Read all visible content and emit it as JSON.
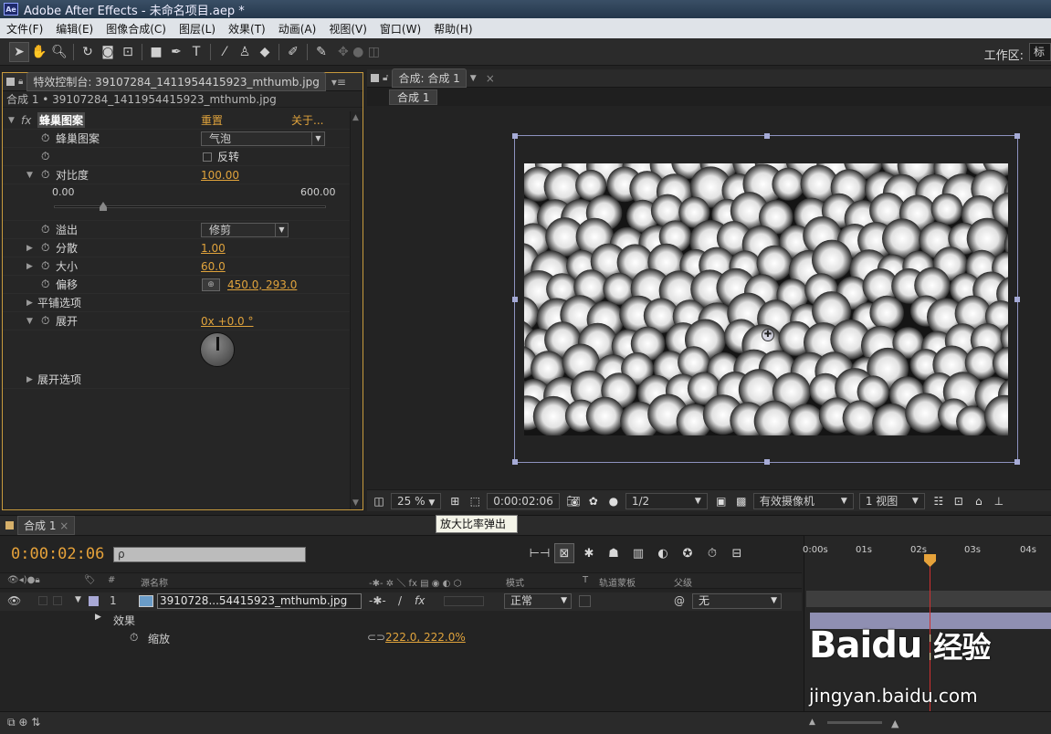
{
  "window": {
    "title": "Adobe After Effects - 未命名项目.aep *",
    "app_icon": "Ae"
  },
  "menu": [
    "文件(F)",
    "编辑(E)",
    "图像合成(C)",
    "图层(L)",
    "效果(T)",
    "动画(A)",
    "视图(V)",
    "窗口(W)",
    "帮助(H)"
  ],
  "toolbar": {
    "workspace_label": "工作区:",
    "workspace_value": "标"
  },
  "effect_controls": {
    "tab_title": "特效控制台: 39107284_1411954415923_mthumb.jpg",
    "subtitle": "合成 1 • 39107284_1411954415923_mthumb.jpg",
    "effect_name": "蜂巢图案",
    "reset_label": "重置",
    "about_label": "关于...",
    "props": {
      "pattern_label": "蜂巢图案",
      "pattern_value": "气泡",
      "invert_label": "反转",
      "contrast_label": "对比度",
      "contrast_value": "100.00",
      "slider_min": "0.00",
      "slider_max": "600.00",
      "overflow_label": "溢出",
      "overflow_value": "修剪",
      "disperse_label": "分散",
      "disperse_value": "1.00",
      "size_label": "大小",
      "size_value": "60.0",
      "offset_label": "偏移",
      "offset_value": "450.0, 293.0",
      "tiling_label": "平铺选项",
      "evolution_label": "展开",
      "evolution_value": "0x +0.0 °",
      "evolution_options_label": "展开选项"
    }
  },
  "composition": {
    "tab_title": "合成: 合成 1",
    "chip": "合成 1",
    "footer": {
      "zoom": "25 %",
      "timecode": "0:00:02:06",
      "resolution": "1/2",
      "camera": "有效摄像机",
      "views": "1 视图"
    }
  },
  "tooltip": "放大比率弹出",
  "timeline": {
    "tab_title": "合成 1",
    "timecode": "0:00:02:06",
    "search_placeholder": "ρ",
    "columns": {
      "num": "#",
      "source": "源名称",
      "mode": "模式",
      "t": "T",
      "trkmat": "轨道蒙板",
      "parent": "父级"
    },
    "layer": {
      "index": "1",
      "name": "3910728...54415923_mthumb.jpg",
      "mode": "正常",
      "parent": "无"
    },
    "effects_label": "效果",
    "scale_label": "缩放",
    "scale_value": "222.0, 222.0%",
    "ruler": [
      "0:00s",
      "01s",
      "02s",
      "03s",
      "04s"
    ],
    "playhead_seconds": 2.25
  },
  "watermark": {
    "brand": "Baidu",
    "cn": "经验",
    "site": "jingyan.baidu.com"
  }
}
